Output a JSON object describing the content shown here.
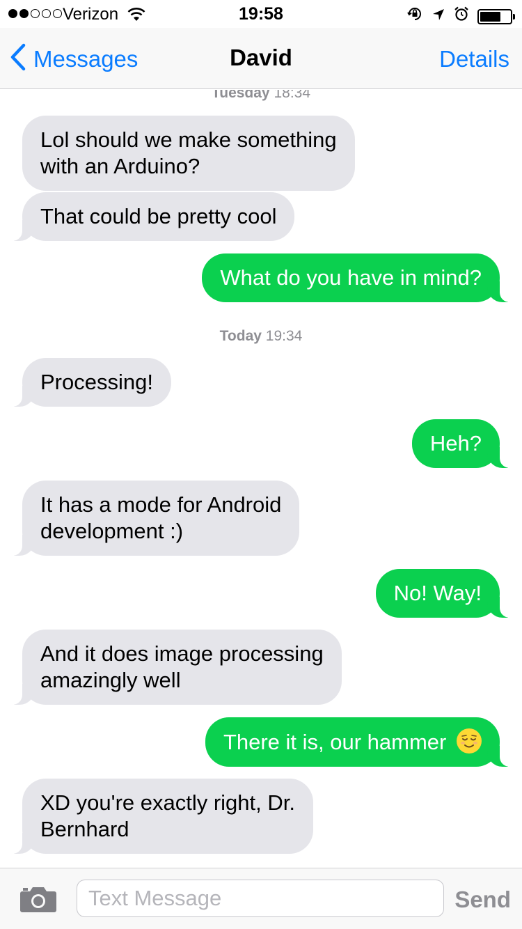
{
  "status_bar": {
    "carrier": "Verizon",
    "time": "19:58",
    "signal_bars_filled": 2,
    "signal_bars_total": 5,
    "battery_level": 0.7
  },
  "nav": {
    "back_label": "Messages",
    "title": "David",
    "details_label": "Details"
  },
  "timestamps": [
    {
      "day": "Tuesday",
      "time": "18:34"
    },
    {
      "day": "Today",
      "time": "19:34"
    }
  ],
  "messages": [
    {
      "direction": "received",
      "text_lines": [
        "Lol should we make something",
        "with an Arduino?"
      ]
    },
    {
      "direction": "received",
      "text_lines": [
        "That could be pretty cool"
      ]
    },
    {
      "direction": "sent",
      "text_lines": [
        "What do you have in mind?"
      ]
    },
    {
      "direction": "received",
      "text_lines": [
        "Processing!"
      ]
    },
    {
      "direction": "sent",
      "text_lines": [
        "Heh?"
      ]
    },
    {
      "direction": "received",
      "text_lines": [
        "It has a mode for Android",
        "development :)"
      ]
    },
    {
      "direction": "sent",
      "text_lines": [
        "No! Way!"
      ]
    },
    {
      "direction": "received",
      "text_lines": [
        "And it does image processing",
        "amazingly well"
      ]
    },
    {
      "direction": "sent",
      "text_lines": [
        "There it is, our hammer"
      ],
      "emoji": "relieved-face-emoji"
    },
    {
      "direction": "received",
      "text_lines": [
        "XD you're exactly right, Dr.",
        "Bernhard"
      ]
    }
  ],
  "input": {
    "placeholder": "Text Message",
    "send_label": "Send"
  },
  "colors": {
    "accent_blue": "#0a7cff",
    "sent_bubble": "#0bd04f",
    "received_bubble": "#e5e5ea",
    "timestamp_gray": "#8e8e93"
  },
  "icons": [
    "wifi-icon",
    "orientation-lock-icon",
    "location-arrow-icon",
    "alarm-icon",
    "battery-icon",
    "back-chevron-icon",
    "camera-icon"
  ]
}
